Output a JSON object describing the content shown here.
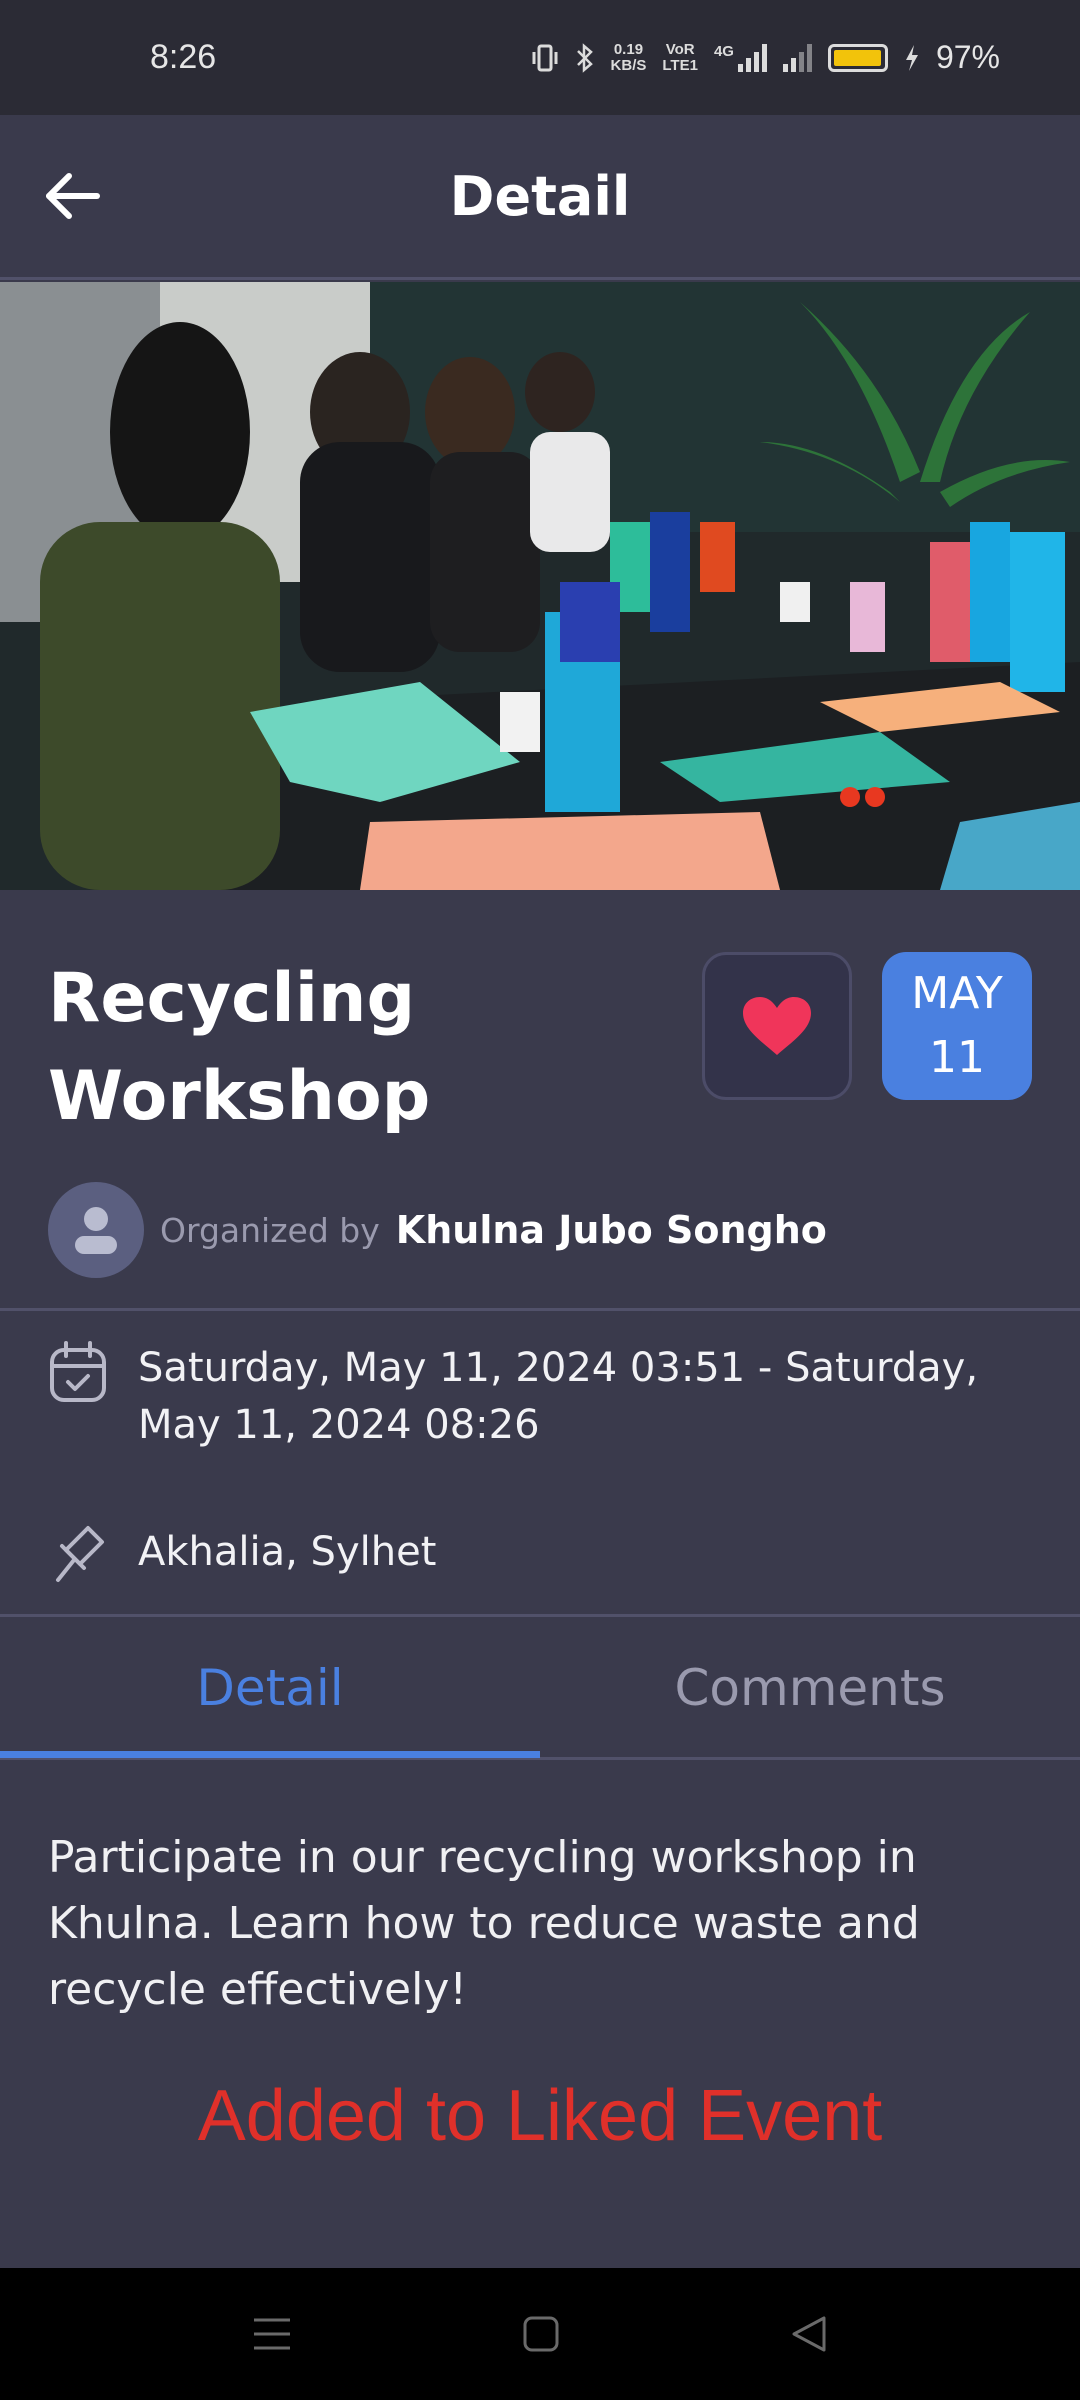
{
  "status_bar": {
    "time": "8:26",
    "net_speed_value": "0.19",
    "net_speed_unit": "KB/S",
    "volte_top": "VoR",
    "volte_bottom": "LTE1",
    "network_type": "4G",
    "battery_percent": "97%",
    "battery_level": 0.97
  },
  "app_bar": {
    "title": "Detail",
    "back_icon": "arrow-left-icon"
  },
  "event": {
    "title": "Recycling Workshop",
    "liked": true,
    "date_month": "MAY",
    "date_day": "11",
    "organizer_prefix": "Organized by",
    "organizer_name": "Khulna Jubo Songho",
    "datetime": "Saturday, May 11, 2024 03:51 - Saturday, May 11, 2024 08:26",
    "location": "Akhalia, Sylhet",
    "description": "Participate in our recycling workshop in Khulna. Learn how to reduce waste and recycle effectively!"
  },
  "tabs": [
    {
      "label": "Detail",
      "active": true
    },
    {
      "label": "Comments",
      "active": false
    }
  ],
  "toast": "Added to Liked Event",
  "colors": {
    "background": "#3a3a4c",
    "accent": "#4a80e0",
    "heart": "#f0355a",
    "toast": "#e0302a"
  }
}
